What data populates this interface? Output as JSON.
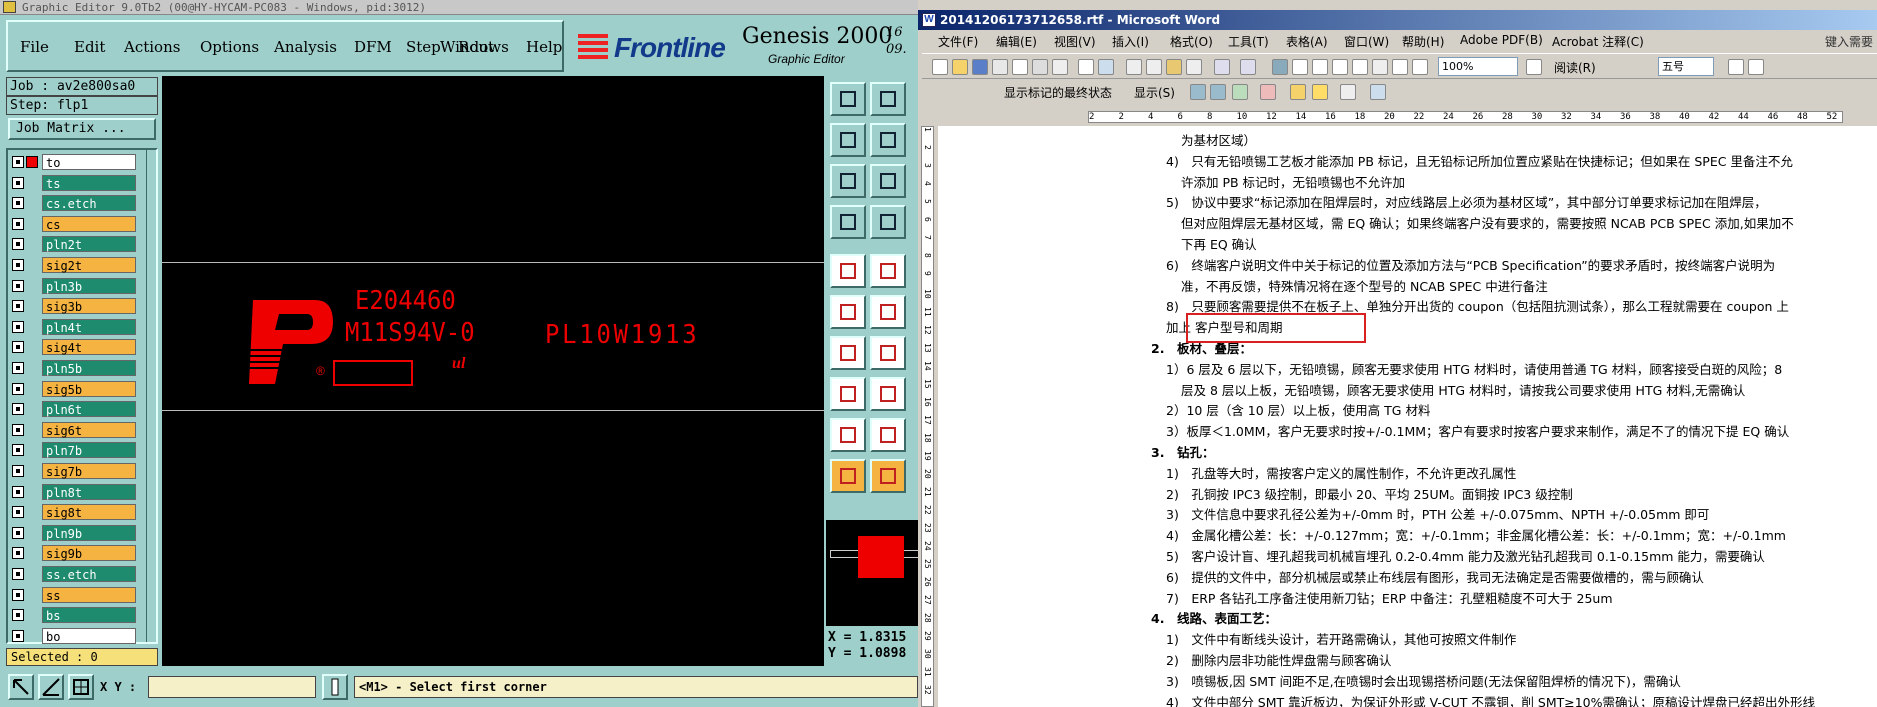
{
  "genesis": {
    "title": "Graphic Editor 9.0Tb2 (00@HY-HYCAM-PC083 - Windows, pid:3012)",
    "menu": [
      "File",
      "Edit",
      "Actions",
      "Options",
      "Analysis",
      "DFM",
      "Step",
      "Rout",
      "Windows",
      "Help"
    ],
    "brand": "Frontline",
    "product": "Genesis 2000",
    "product_sub": "Graphic Editor",
    "date_line1": "16",
    "date_line2": "09.",
    "job": "Job : av2e800sa0",
    "step": "Step: flp1",
    "job_matrix": "Job Matrix ...",
    "layers": [
      {
        "name": "to",
        "color": "white"
      },
      {
        "name": "ts",
        "color": "green"
      },
      {
        "name": "cs.etch",
        "color": "green"
      },
      {
        "name": "cs",
        "color": "orange"
      },
      {
        "name": "pln2t",
        "color": "green"
      },
      {
        "name": "sig2t",
        "color": "orange"
      },
      {
        "name": "pln3b",
        "color": "green"
      },
      {
        "name": "sig3b",
        "color": "orange"
      },
      {
        "name": "pln4t",
        "color": "green"
      },
      {
        "name": "sig4t",
        "color": "orange"
      },
      {
        "name": "pln5b",
        "color": "green"
      },
      {
        "name": "sig5b",
        "color": "orange"
      },
      {
        "name": "pln6t",
        "color": "green"
      },
      {
        "name": "sig6t",
        "color": "orange"
      },
      {
        "name": "pln7b",
        "color": "green"
      },
      {
        "name": "sig7b",
        "color": "orange"
      },
      {
        "name": "pln8t",
        "color": "green"
      },
      {
        "name": "sig8t",
        "color": "orange"
      },
      {
        "name": "pln9b",
        "color": "green"
      },
      {
        "name": "sig9b",
        "color": "orange"
      },
      {
        "name": "ss.etch",
        "color": "green"
      },
      {
        "name": "ss",
        "color": "orange"
      },
      {
        "name": "bs",
        "color": "green"
      },
      {
        "name": "bo",
        "color": "white"
      }
    ],
    "selected": "Selected : 0",
    "canvas_text": {
      "line1": "E204460",
      "line2": "M11S94V-0",
      "line3": "PL10W1913",
      "reg": "®"
    },
    "coords": {
      "x": "X = 1.8315",
      "y": "Y = 1.0898"
    },
    "xy_label": "X Y :",
    "prompt": "<M1> - Select first corner",
    "colors": {
      "bg": "#9ecfca",
      "layer_green": "#1e8b6e",
      "layer_orange": "#f5b442",
      "pcb_red": "#ee0000"
    }
  },
  "word": {
    "title": "20141206173712658.rtf - Microsoft Word",
    "menu": [
      "文件(F)",
      "编辑(E)",
      "视图(V)",
      "插入(I)",
      "格式(O)",
      "工具(T)",
      "表格(A)",
      "窗口(W)",
      "帮助(H)",
      "Adobe PDF(B)",
      "Acrobat 注释(C)"
    ],
    "ask": "键入需要",
    "zoom": "100%",
    "read_btn": "阅读(R)",
    "font_size": "五号",
    "markup_state": "显示标记的最终状态",
    "show_btn": "显示(S)",
    "ruler": [
      "2",
      "2",
      "4",
      "6",
      "8",
      "10",
      "12",
      "14",
      "16",
      "18",
      "20",
      "22",
      "24",
      "26",
      "28",
      "30",
      "32",
      "34",
      "36",
      "38",
      "40",
      "42",
      "44",
      "46",
      "48",
      "52"
    ],
    "vruler": [
      "1",
      "2",
      "3",
      "4",
      "5",
      "6",
      "7",
      "8",
      "9",
      "10",
      "11",
      "12",
      "13",
      "14",
      "15",
      "16",
      "17",
      "18",
      "19",
      "20",
      "21",
      "22",
      "23",
      "24",
      "25",
      "26",
      "27",
      "28",
      "29",
      "30",
      "31",
      "32"
    ],
    "doc": [
      {
        "t": "为基材区域）"
      },
      {
        "t": "4)　只有无铅喷锡工艺板才能添加 PB 标记，且无铅标记所加位置应紧贴在快捷标记；但如果在 SPEC 里备注不允"
      },
      {
        "t": "许添加 PB 标记时，无铅喷锡也不允许加"
      },
      {
        "t": "5)　协议中要求“标记添加在阻焊层时，对应线路层上必须为基材区域”，其中部分订单要求标记加在阻焊层，"
      },
      {
        "t": "但对应阻焊层无基材区域，需 EQ 确认；如果终端客户没有要求的，需要按照 NCAB PCB SPEC 添加,如果加不"
      },
      {
        "t": "下再 EQ 确认"
      },
      {
        "t": "6)　终端客户说明文件中关于标记的位置及添加方法与“PCB Specification”的要求矛盾时，按终端客户说明为"
      },
      {
        "t": "准，不再反馈，特殊情况将在逐个型号的 NCAB SPEC 中进行备注"
      },
      {
        "t": "8)　只要顾客需要提供不在板子上、单独分开出货的 coupon（包括阻抗测试条），那么工程就需要在 coupon 上"
      },
      {
        "t": "加上 客户型号和周期"
      },
      {
        "t": "2.　板材、叠层："
      },
      {
        "t": "1）6 层及 6 层以下，无铅喷锡，顾客无要求使用 HTG 材料时，请使用普通 TG 材料，顾客接受白斑的风险；8"
      },
      {
        "t": "层及 8 层以上板，无铅喷锡，顾客无要求使用 HTG 材料时，请按我公司要求使用 HTG 材料,无需确认"
      },
      {
        "t": "2）10 层（含 10 层）以上板，使用高 TG 材料"
      },
      {
        "t": "3）板厚＜1.0MM，客户无要求时按+/-0.1MM；客户有要求时按客户要求来制作，满足不了的情况下提 EQ 确认"
      },
      {
        "t": "3.　钻孔："
      },
      {
        "t": "1)　孔盘等大时，需按客户定义的属性制作，不允许更改孔属性"
      },
      {
        "t": "2)　孔铜按 IPC3 级控制，即最小 20、平均 25UM。面铜按 IPC3 级控制"
      },
      {
        "t": "3)　文件信息中要求孔径公差为+/-0mm 时，PTH 公差 +/-0.075mm、NPTH +/-0.05mm 即可"
      },
      {
        "t": "4)　金属化槽公差：长：+/-0.127mm；宽：+/-0.1mm；非金属化槽公差：长：+/-0.1mm；宽：+/-0.1mm"
      },
      {
        "t": "5)　客户设计盲、埋孔超我司机械盲埋孔 0.2-0.4mm 能力及激光钻孔超我司 0.1-0.15mm 能力，需要确认"
      },
      {
        "t": "6)　提供的文件中，部分机械层或禁止布线层有图形，我司无法确定是否需要做槽的，需与顾确认"
      },
      {
        "t": "7)　ERP 各钻孔工序备注使用新刀钻；ERP 中备注：孔壁粗糙度不可大于 25um"
      },
      {
        "t": "4.　线路、表面工艺："
      },
      {
        "t": "1)　文件中有断线头设计，若开路需确认，其他可按照文件制作"
      },
      {
        "t": "2)　删除内层非功能性焊盘需与顾客确认"
      },
      {
        "t": "3)　喷锡板,因 SMT 间距不足,在喷锡时会出现锡搭桥问题(无法保留阻焊桥的情况下)，需确认"
      },
      {
        "t": "4)　文件中部分 SMT 靠近板边，为保证外形或 V-CUT 不露铜，削 SMT≥10%需确认；原稿设计焊盘已经超出外形线"
      }
    ]
  }
}
